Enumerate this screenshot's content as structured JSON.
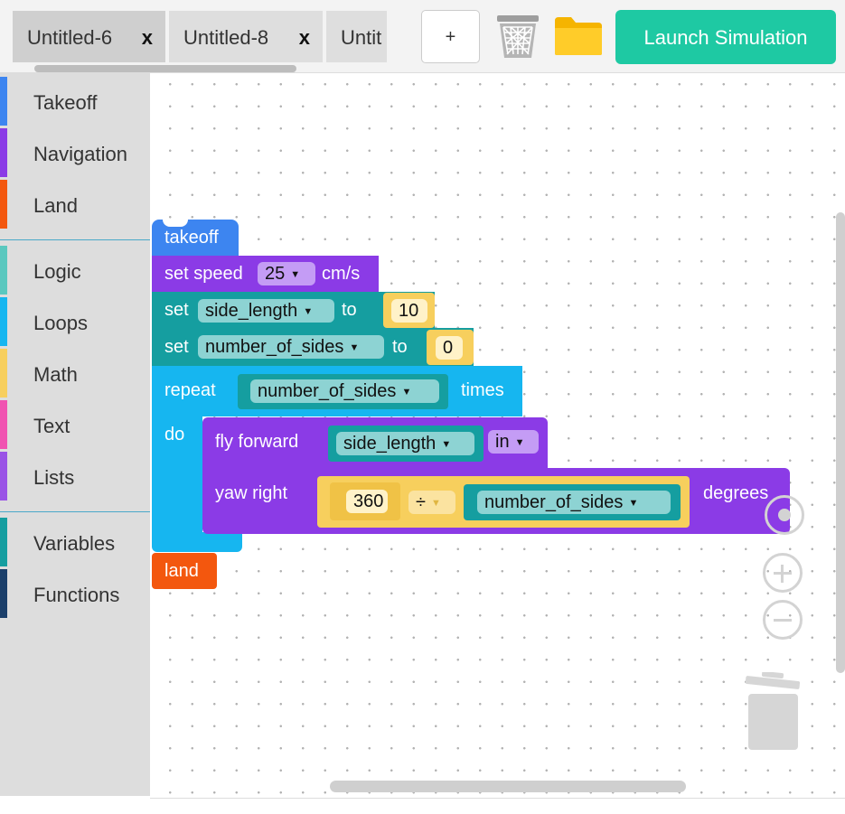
{
  "tabs": [
    {
      "label": "Untitled-6",
      "close": "x"
    },
    {
      "label": "Untitled-8",
      "close": "x"
    },
    {
      "label": "Untit"
    }
  ],
  "toolbar": {
    "new_label": "+",
    "launch_label": "Launch Simulation"
  },
  "toolbox": {
    "categories": [
      {
        "label": "Takeoff",
        "color": "#3d85f0"
      },
      {
        "label": "Navigation",
        "color": "#8b3be6"
      },
      {
        "label": "Land",
        "color": "#f3570e"
      },
      {
        "label": "Logic",
        "color": "#5ac8bf"
      },
      {
        "label": "Loops",
        "color": "#16b6f0"
      },
      {
        "label": "Math",
        "color": "#f7cf5d"
      },
      {
        "label": "Text",
        "color": "#f053b1"
      },
      {
        "label": "Lists",
        "color": "#9a53e6"
      },
      {
        "label": "Variables",
        "color": "#159ea0"
      },
      {
        "label": "Functions",
        "color": "#1b3f6a"
      }
    ]
  },
  "blocks": {
    "takeoff": "takeoff",
    "set_speed": {
      "label": "set speed",
      "value": "25",
      "unit": "cm/s"
    },
    "set1": {
      "label": "set",
      "var": "side_length",
      "to": "to",
      "value": "10"
    },
    "set2": {
      "label": "set",
      "var": "number_of_sides",
      "to": "to",
      "value": "0"
    },
    "repeat": {
      "label": "repeat",
      "var": "number_of_sides",
      "times": "times",
      "do": "do"
    },
    "fly": {
      "label": "fly forward",
      "var": "side_length",
      "unit": "in"
    },
    "yaw": {
      "label": "yaw right",
      "num": "360",
      "op": "÷",
      "var": "number_of_sides",
      "unit": "degrees"
    },
    "land": "land"
  }
}
